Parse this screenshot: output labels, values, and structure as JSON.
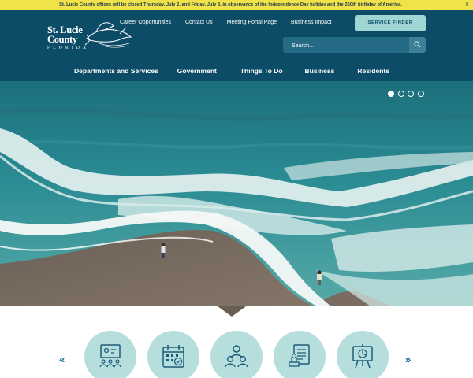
{
  "alert": {
    "text": "St. Lucie County offices will be closed Thursday, July 2, and Friday, July 3, in observance of the Independence Day holiday and the 250th birthday of America.",
    "close_icon": "close-icon"
  },
  "logo": {
    "line1": "St. Lucie",
    "line2": "County",
    "line3": "FLORIDA"
  },
  "top_links": [
    "Career Opportunities",
    "Contact Us",
    "Meeting Portal Page",
    "Business Impact"
  ],
  "service_finder": {
    "label": "SERVICE FINDER"
  },
  "search": {
    "placeholder": "Search...",
    "icon": "search-icon"
  },
  "nav": [
    "Departments and Services",
    "Government",
    "Things To Do",
    "Business",
    "Residents"
  ],
  "hero": {
    "slide_count": 4,
    "active_slide": 1
  },
  "quick_links": {
    "prev_label": "«",
    "next_label": "»",
    "icons": [
      "meeting-icon",
      "calendar-icon",
      "people-icon",
      "document-stamp-icon",
      "presentation-icon"
    ]
  },
  "colors": {
    "alert_bg": "#f2e24a",
    "header_bg": "#0d4c67",
    "service_finder_bg": "#9fd6d4",
    "circle_bg": "#b6dedc",
    "icon_color": "#1c5d7a"
  }
}
